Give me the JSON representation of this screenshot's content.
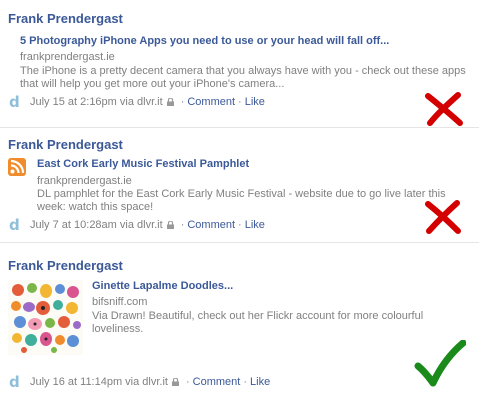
{
  "stories": [
    {
      "author": "Frank Prendergast",
      "title": "5 Photography iPhone Apps you need to use or your head will fall off...",
      "domain": "frankprendergast.ie",
      "description": "The iPhone is a pretty decent camera that you always have with you - check out these apps that will help you get more out your iPhone's camera...",
      "timestamp": "July 15 at 2:16pm via dlvr.it",
      "comment_label": "Comment",
      "like_label": "Like",
      "verdict": "cross"
    },
    {
      "author": "Frank Prendergast",
      "title": "East Cork Early Music Festival Pamphlet",
      "domain": "frankprendergast.ie",
      "description": "DL pamphlet for the East Cork Early Music Festival - website due to go live later this week: watch this space!",
      "timestamp": "July 7 at 10:28am via dlvr.it",
      "comment_label": "Comment",
      "like_label": "Like",
      "verdict": "cross"
    },
    {
      "author": "Frank Prendergast",
      "title": "Ginette Lapalme Doodles...",
      "domain": "bifsniff.com",
      "description": "Via Drawn! Beautiful, check out her Flickr account for more colourful loveliness.",
      "timestamp": "July 16 at 11:14pm via dlvr.it",
      "comment_label": "Comment",
      "like_label": "Like",
      "verdict": "check"
    }
  ],
  "icons": {
    "app": "dlvr-icon",
    "rss": "rss-icon",
    "privacy": "lock-icon",
    "cross": "red-cross-icon",
    "check": "green-checkmark-icon"
  },
  "colors": {
    "link": "#3b5998",
    "muted": "#808080",
    "cross": "#d40000",
    "check": "#1a8a1a"
  },
  "app_glyph": "d"
}
